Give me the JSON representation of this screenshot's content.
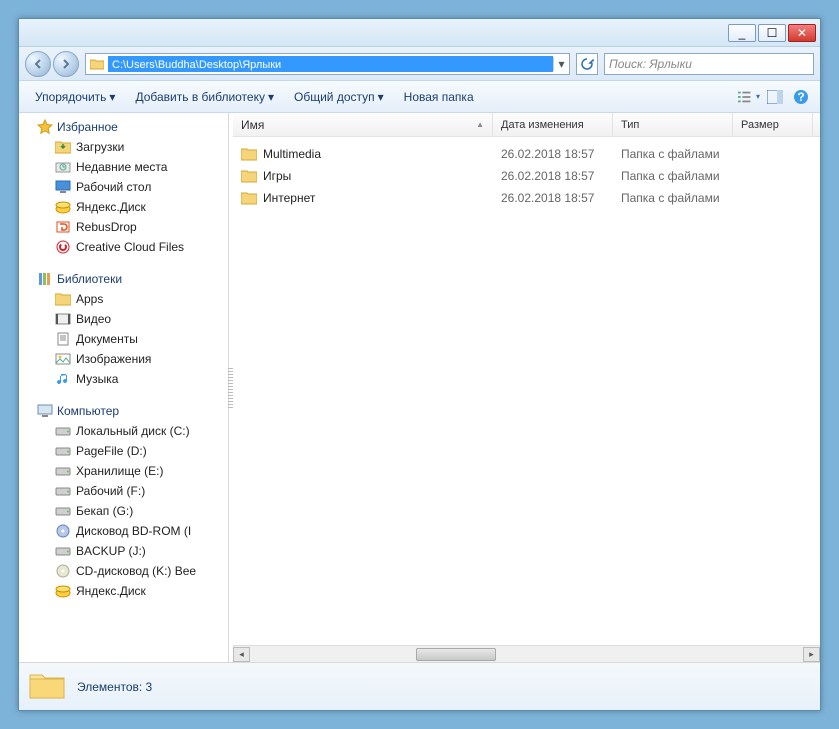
{
  "titlebar": {
    "min": "_",
    "max": "☐",
    "close": "✕"
  },
  "address": {
    "path": "C:\\Users\\Buddha\\Desktop\\Ярлыки"
  },
  "search": {
    "placeholder": "Поиск: Ярлыки"
  },
  "toolbar": {
    "organize": "Упорядочить",
    "add_library": "Добавить в библиотеку",
    "share": "Общий доступ",
    "new_folder": "Новая папка"
  },
  "nav": {
    "favorites": {
      "label": "Избранное",
      "items": [
        {
          "icon": "download",
          "label": "Загрузки"
        },
        {
          "icon": "recent",
          "label": "Недавние места"
        },
        {
          "icon": "desktop",
          "label": "Рабочий стол"
        },
        {
          "icon": "yadisk",
          "label": "Яндекс.Диск"
        },
        {
          "icon": "rebus",
          "label": "RebusDrop"
        },
        {
          "icon": "ccloud",
          "label": "Creative Cloud Files"
        }
      ]
    },
    "libraries": {
      "label": "Библиотеки",
      "items": [
        {
          "icon": "folder",
          "label": "Apps"
        },
        {
          "icon": "video",
          "label": "Видео"
        },
        {
          "icon": "docs",
          "label": "Документы"
        },
        {
          "icon": "images",
          "label": "Изображения"
        },
        {
          "icon": "music",
          "label": "Музыка"
        }
      ]
    },
    "computer": {
      "label": "Компьютер",
      "items": [
        {
          "icon": "hdd",
          "label": "Локальный диск (C:)"
        },
        {
          "icon": "hdd",
          "label": "PageFile (D:)"
        },
        {
          "icon": "hdd",
          "label": "Хранилище (E:)"
        },
        {
          "icon": "hdd",
          "label": "Рабочий (F:)"
        },
        {
          "icon": "hdd",
          "label": "Бекап (G:)"
        },
        {
          "icon": "bd",
          "label": "Дисковод BD-ROM (I"
        },
        {
          "icon": "hdd",
          "label": "BACKUP (J:)"
        },
        {
          "icon": "cd",
          "label": "CD-дисковод (K:) Bee"
        },
        {
          "icon": "yadisk",
          "label": "Яндекс.Диск"
        }
      ]
    }
  },
  "columns": {
    "name": "Имя",
    "date": "Дата изменения",
    "type": "Тип",
    "size": "Размер"
  },
  "files": [
    {
      "name": "Multimedia",
      "date": "26.02.2018 18:57",
      "type": "Папка с файлами"
    },
    {
      "name": "Игры",
      "date": "26.02.2018 18:57",
      "type": "Папка с файлами"
    },
    {
      "name": "Интернет",
      "date": "26.02.2018 18:57",
      "type": "Папка с файлами"
    }
  ],
  "status": {
    "count": "Элементов: 3"
  }
}
